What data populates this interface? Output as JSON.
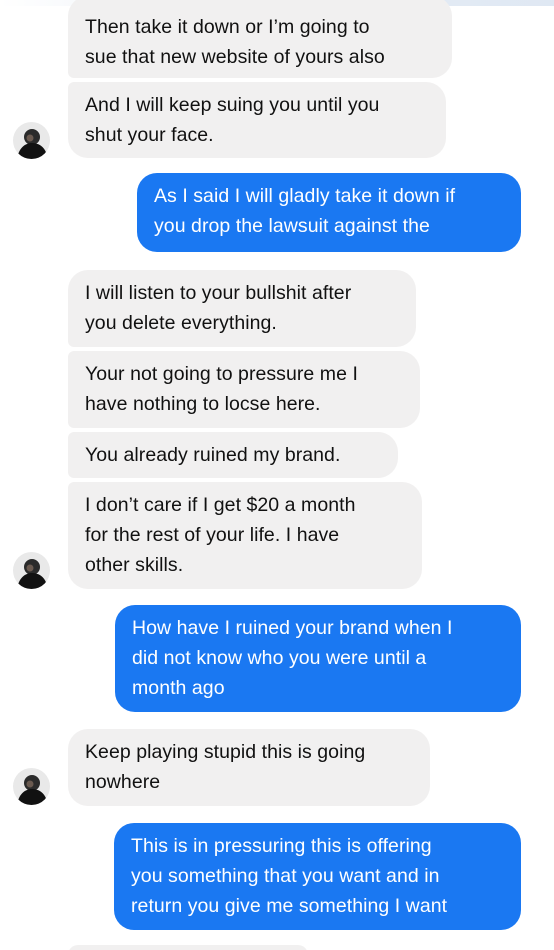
{
  "thread": {
    "messages": [
      {
        "sender": "them",
        "lines": [
          "Then take it down or I’m going to",
          "sue that new website of yours also"
        ]
      },
      {
        "sender": "them",
        "lines": [
          "And I will keep suing you until you",
          "shut your face."
        ]
      },
      {
        "sender": "me",
        "lines": [
          "As I said I will gladly take it down if",
          "you drop the lawsuit against the"
        ]
      },
      {
        "sender": "them",
        "lines": [
          "I will listen to your bullshit after",
          "you delete everything."
        ]
      },
      {
        "sender": "them",
        "lines": [
          "Your not going to pressure me I",
          "have nothing to locse here."
        ]
      },
      {
        "sender": "them",
        "lines": [
          "You already ruined my brand."
        ]
      },
      {
        "sender": "them",
        "lines": [
          "I don’t care if I get $20 a month",
          "for the rest of your life. I have",
          "other skills."
        ]
      },
      {
        "sender": "me",
        "lines": [
          "How have I ruined your brand when I",
          "did not know who you were until a",
          "month ago"
        ]
      },
      {
        "sender": "them",
        "lines": [
          "Keep playing stupid this is going",
          "nowhere"
        ]
      },
      {
        "sender": "me",
        "lines": [
          "This is in pressuring this is offering",
          "you something that you want and in",
          "return you give me something I want"
        ]
      }
    ]
  },
  "colors": {
    "incoming_bubble": "#f1f0f0",
    "outgoing_bubble": "#1a78f2",
    "incoming_text": "#111111",
    "outgoing_text": "#ffffff"
  },
  "icons": {
    "avatar": "contact-avatar-icon"
  }
}
